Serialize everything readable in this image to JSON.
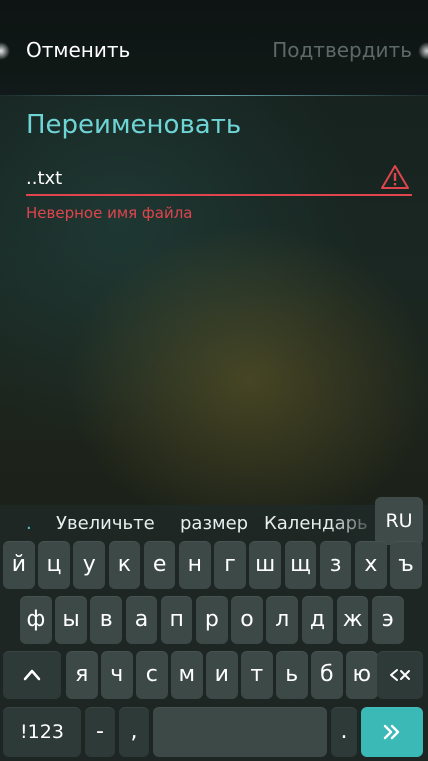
{
  "header": {
    "cancel_label": "Отменить",
    "confirm_label": "Подтвердить"
  },
  "dialog": {
    "title": "Переименовать",
    "filename_value": "..txt",
    "error_text": "Неверное имя файла",
    "error_color": "#e0444d",
    "accent_color": "#6fd4d6"
  },
  "keyboard": {
    "suggestion_dot": ".",
    "suggestions": [
      "Увеличьте",
      "размер",
      "Календарь"
    ],
    "language": "RU",
    "row1": [
      "й",
      "ц",
      "у",
      "к",
      "е",
      "н",
      "г",
      "ш",
      "щ",
      "з",
      "х",
      "ъ"
    ],
    "row2": [
      "ф",
      "ы",
      "в",
      "а",
      "п",
      "р",
      "о",
      "л",
      "д",
      "ж",
      "э"
    ],
    "row3": [
      "я",
      "ч",
      "с",
      "м",
      "и",
      "т",
      "ь",
      "б",
      "ю"
    ],
    "shift_icon": "shift-icon",
    "backspace_icon": "backspace-icon",
    "symbols_label": "!123",
    "dash_label": "-",
    "comma_label": ",",
    "period_label": ".",
    "enter_icon": "enter-arrow-icon",
    "action_color": "#3bb9b7"
  }
}
